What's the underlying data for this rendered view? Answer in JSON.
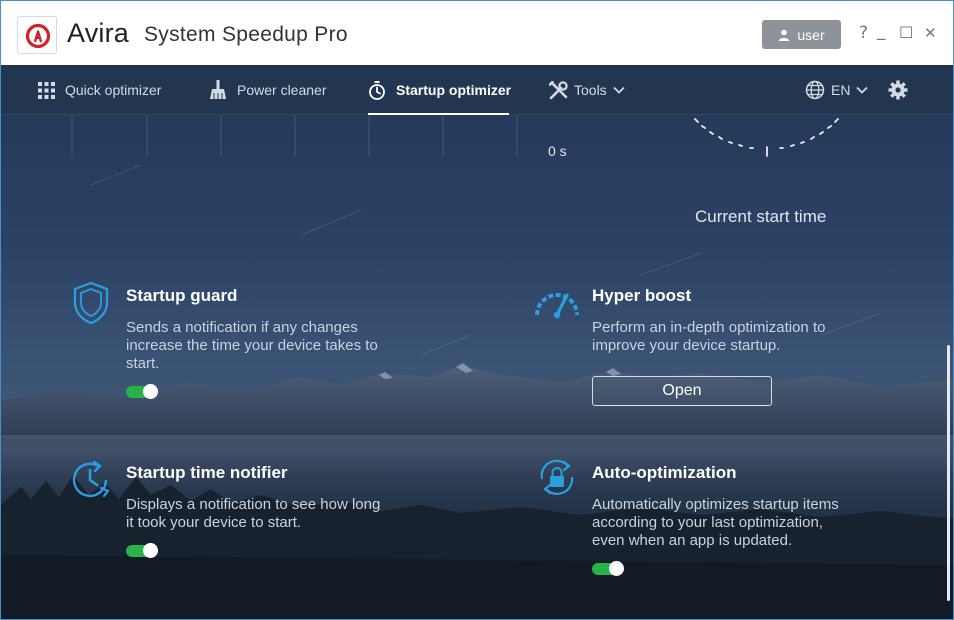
{
  "titlebar": {
    "brand": "Avira",
    "product": "System Speedup Pro",
    "user_label": "user",
    "help": "?",
    "minimize": "_",
    "maximize": "☐",
    "close": "✕"
  },
  "nav": {
    "items": [
      {
        "label": "Quick optimizer",
        "icon": "grid-icon"
      },
      {
        "label": "Power cleaner",
        "icon": "broom-icon"
      },
      {
        "label": "Startup optimizer",
        "icon": "stopwatch-icon",
        "active": true
      },
      {
        "label": "Tools",
        "icon": "tools-icon"
      }
    ],
    "language": "EN"
  },
  "gauge": {
    "zero_label": "0 s",
    "caption": "Current start time"
  },
  "features": [
    {
      "title": "Startup guard",
      "description_lines": [
        "Sends a notification if any changes",
        "increase the time your device takes to",
        "start."
      ],
      "toggle_on": true
    },
    {
      "title": "Hyper boost",
      "description_lines": [
        "Perform an in-depth optimization to",
        "improve your device startup."
      ],
      "button_label": "Open"
    },
    {
      "title": "Startup time notifier",
      "description_lines": [
        "Displays a notification to see how long",
        "it took your device to start."
      ],
      "toggle_on": true
    },
    {
      "title": "Auto-optimization",
      "description_lines": [
        "Automatically optimizes startup items",
        "according to your last optimization,",
        "even when an app is updated."
      ],
      "toggle_on": true
    }
  ],
  "colors": {
    "accent_red": "#d42027",
    "nav_bg": "#233650",
    "icon_blue": "#2a9fe0",
    "toggle_green": "#27b34a"
  }
}
